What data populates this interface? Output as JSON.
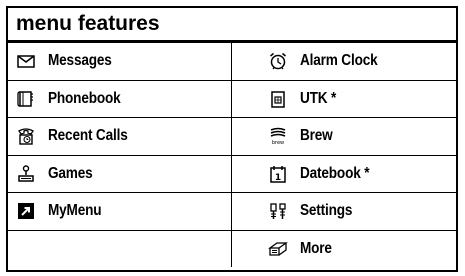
{
  "title": "menu features",
  "rows": [
    [
      {
        "label": "Messages",
        "icon": "envelope-icon"
      },
      {
        "label": "Alarm Clock",
        "icon": "alarm-clock-icon"
      }
    ],
    [
      {
        "label": "Phonebook",
        "icon": "phonebook-icon"
      },
      {
        "label": "UTK *",
        "icon": "sim-card-icon"
      }
    ],
    [
      {
        "label": "Recent Calls",
        "icon": "recent-calls-icon"
      },
      {
        "label": "Brew",
        "icon": "brew-icon"
      }
    ],
    [
      {
        "label": "Games",
        "icon": "joystick-icon"
      },
      {
        "label": "Datebook *",
        "icon": "calendar-icon"
      }
    ],
    [
      {
        "label": "MyMenu",
        "icon": "shortcut-arrow-icon"
      },
      {
        "label": "Settings",
        "icon": "settings-icon"
      }
    ],
    [
      {
        "label": "",
        "icon": ""
      },
      {
        "label": "More",
        "icon": "more-folder-icon"
      }
    ]
  ]
}
